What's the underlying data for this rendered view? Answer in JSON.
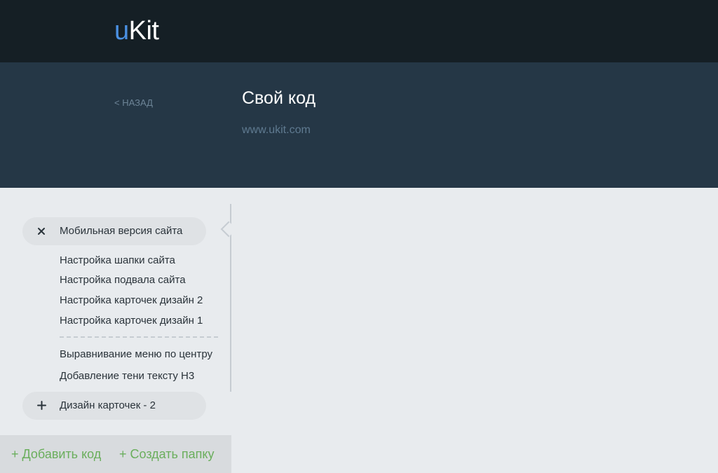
{
  "brand": {
    "logo_prefix": "u",
    "logo_suffix": "Kit"
  },
  "header": {
    "back_label": "< НАЗАД",
    "title": "Свой код",
    "url": "www.ukit.com"
  },
  "sidebar": {
    "folders": [
      {
        "label": "Мобильная версия сайта",
        "icon": "close-icon",
        "expanded": true,
        "items": [
          "Настройка шапки сайта",
          "Настройка подвала сайта",
          "Настройка карточек дизайн 2",
          "Настройка карточек дизайн 1"
        ]
      },
      {
        "label": "Дизайн карточек - 2",
        "icon": "plus-icon",
        "expanded": false,
        "items": []
      }
    ],
    "loose_items": [
      "Выравнивание меню по центру",
      "Добавление тени тексту H3"
    ]
  },
  "actions": {
    "add_code": "+ Добавить код",
    "create_folder": "+ Создать папку"
  },
  "colors": {
    "topbar": "#151f25",
    "header": "#253746",
    "accent_logo": "#4a90e2",
    "action_green": "#6aae5c",
    "background": "#e8ebee"
  }
}
